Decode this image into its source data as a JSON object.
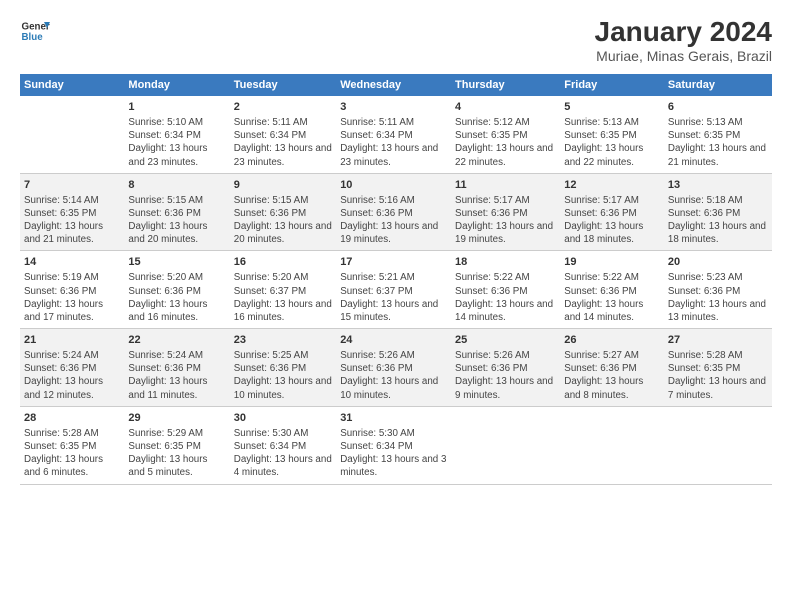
{
  "logo": {
    "line1": "General",
    "line2": "Blue"
  },
  "title": "January 2024",
  "subtitle": "Muriae, Minas Gerais, Brazil",
  "columns": [
    "Sunday",
    "Monday",
    "Tuesday",
    "Wednesday",
    "Thursday",
    "Friday",
    "Saturday"
  ],
  "weeks": [
    [
      {
        "day": "",
        "info": ""
      },
      {
        "day": "1",
        "sunrise": "5:10 AM",
        "sunset": "6:34 PM",
        "daylight": "13 hours and 23 minutes."
      },
      {
        "day": "2",
        "sunrise": "5:11 AM",
        "sunset": "6:34 PM",
        "daylight": "13 hours and 23 minutes."
      },
      {
        "day": "3",
        "sunrise": "5:11 AM",
        "sunset": "6:34 PM",
        "daylight": "13 hours and 23 minutes."
      },
      {
        "day": "4",
        "sunrise": "5:12 AM",
        "sunset": "6:35 PM",
        "daylight": "13 hours and 22 minutes."
      },
      {
        "day": "5",
        "sunrise": "5:13 AM",
        "sunset": "6:35 PM",
        "daylight": "13 hours and 22 minutes."
      },
      {
        "day": "6",
        "sunrise": "5:13 AM",
        "sunset": "6:35 PM",
        "daylight": "13 hours and 21 minutes."
      }
    ],
    [
      {
        "day": "7",
        "sunrise": "5:14 AM",
        "sunset": "6:35 PM",
        "daylight": "13 hours and 21 minutes."
      },
      {
        "day": "8",
        "sunrise": "5:15 AM",
        "sunset": "6:36 PM",
        "daylight": "13 hours and 20 minutes."
      },
      {
        "day": "9",
        "sunrise": "5:15 AM",
        "sunset": "6:36 PM",
        "daylight": "13 hours and 20 minutes."
      },
      {
        "day": "10",
        "sunrise": "5:16 AM",
        "sunset": "6:36 PM",
        "daylight": "13 hours and 19 minutes."
      },
      {
        "day": "11",
        "sunrise": "5:17 AM",
        "sunset": "6:36 PM",
        "daylight": "13 hours and 19 minutes."
      },
      {
        "day": "12",
        "sunrise": "5:17 AM",
        "sunset": "6:36 PM",
        "daylight": "13 hours and 18 minutes."
      },
      {
        "day": "13",
        "sunrise": "5:18 AM",
        "sunset": "6:36 PM",
        "daylight": "13 hours and 18 minutes."
      }
    ],
    [
      {
        "day": "14",
        "sunrise": "5:19 AM",
        "sunset": "6:36 PM",
        "daylight": "13 hours and 17 minutes."
      },
      {
        "day": "15",
        "sunrise": "5:20 AM",
        "sunset": "6:36 PM",
        "daylight": "13 hours and 16 minutes."
      },
      {
        "day": "16",
        "sunrise": "5:20 AM",
        "sunset": "6:37 PM",
        "daylight": "13 hours and 16 minutes."
      },
      {
        "day": "17",
        "sunrise": "5:21 AM",
        "sunset": "6:37 PM",
        "daylight": "13 hours and 15 minutes."
      },
      {
        "day": "18",
        "sunrise": "5:22 AM",
        "sunset": "6:36 PM",
        "daylight": "13 hours and 14 minutes."
      },
      {
        "day": "19",
        "sunrise": "5:22 AM",
        "sunset": "6:36 PM",
        "daylight": "13 hours and 14 minutes."
      },
      {
        "day": "20",
        "sunrise": "5:23 AM",
        "sunset": "6:36 PM",
        "daylight": "13 hours and 13 minutes."
      }
    ],
    [
      {
        "day": "21",
        "sunrise": "5:24 AM",
        "sunset": "6:36 PM",
        "daylight": "13 hours and 12 minutes."
      },
      {
        "day": "22",
        "sunrise": "5:24 AM",
        "sunset": "6:36 PM",
        "daylight": "13 hours and 11 minutes."
      },
      {
        "day": "23",
        "sunrise": "5:25 AM",
        "sunset": "6:36 PM",
        "daylight": "13 hours and 10 minutes."
      },
      {
        "day": "24",
        "sunrise": "5:26 AM",
        "sunset": "6:36 PM",
        "daylight": "13 hours and 10 minutes."
      },
      {
        "day": "25",
        "sunrise": "5:26 AM",
        "sunset": "6:36 PM",
        "daylight": "13 hours and 9 minutes."
      },
      {
        "day": "26",
        "sunrise": "5:27 AM",
        "sunset": "6:36 PM",
        "daylight": "13 hours and 8 minutes."
      },
      {
        "day": "27",
        "sunrise": "5:28 AM",
        "sunset": "6:35 PM",
        "daylight": "13 hours and 7 minutes."
      }
    ],
    [
      {
        "day": "28",
        "sunrise": "5:28 AM",
        "sunset": "6:35 PM",
        "daylight": "13 hours and 6 minutes."
      },
      {
        "day": "29",
        "sunrise": "5:29 AM",
        "sunset": "6:35 PM",
        "daylight": "13 hours and 5 minutes."
      },
      {
        "day": "30",
        "sunrise": "5:30 AM",
        "sunset": "6:34 PM",
        "daylight": "13 hours and 4 minutes."
      },
      {
        "day": "31",
        "sunrise": "5:30 AM",
        "sunset": "6:34 PM",
        "daylight": "13 hours and 3 minutes."
      },
      {
        "day": "",
        "info": ""
      },
      {
        "day": "",
        "info": ""
      },
      {
        "day": "",
        "info": ""
      }
    ]
  ]
}
